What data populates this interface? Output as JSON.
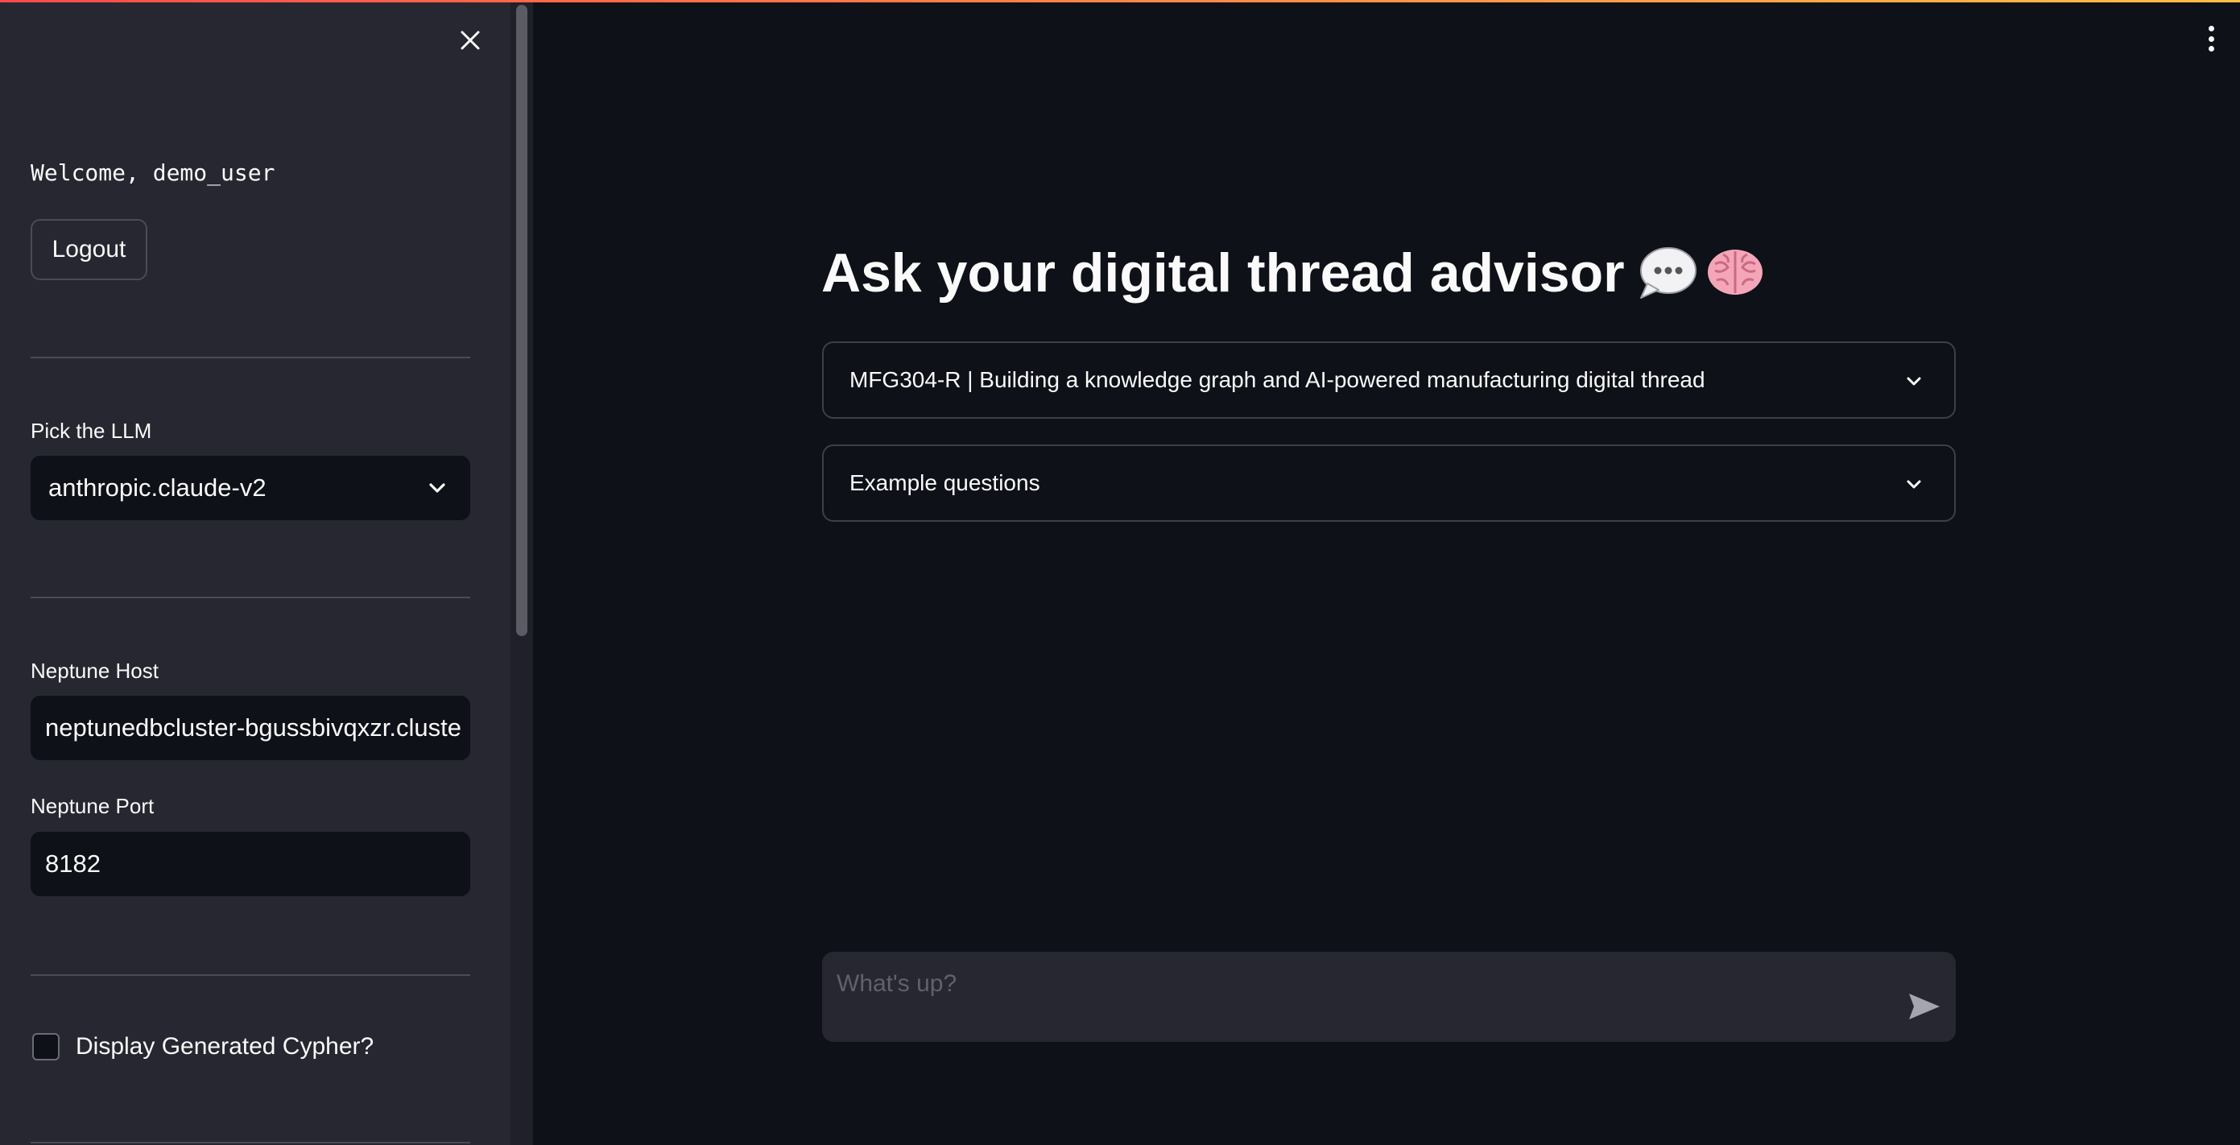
{
  "sidebar": {
    "welcome_text": "Welcome, demo_user",
    "logout_label": "Logout",
    "llm_label": "Pick the LLM",
    "llm_selected": "anthropic.claude-v2",
    "host_label": "Neptune Host",
    "host_value": "neptunedbcluster-bgussbivqxzr.cluste",
    "port_label": "Neptune Port",
    "port_value": "8182",
    "cypher_checkbox_label": "Display Generated Cypher?",
    "cypher_checked": false
  },
  "main": {
    "title": "Ask your digital thread advisor",
    "title_icons": [
      "speech-bubble-icon",
      "brain-icon"
    ],
    "expanders": [
      {
        "label": "MFG304-R | Building a knowledge graph and AI-powered manufacturing digital thread"
      },
      {
        "label": "Example questions"
      }
    ],
    "chat": {
      "placeholder": "What's up?"
    }
  },
  "colors": {
    "background": "#0e1117",
    "sidebar": "#262730",
    "accent_start": "#ff4b4b",
    "accent_end": "#ffbd45",
    "brain": "#f4a6b8"
  }
}
